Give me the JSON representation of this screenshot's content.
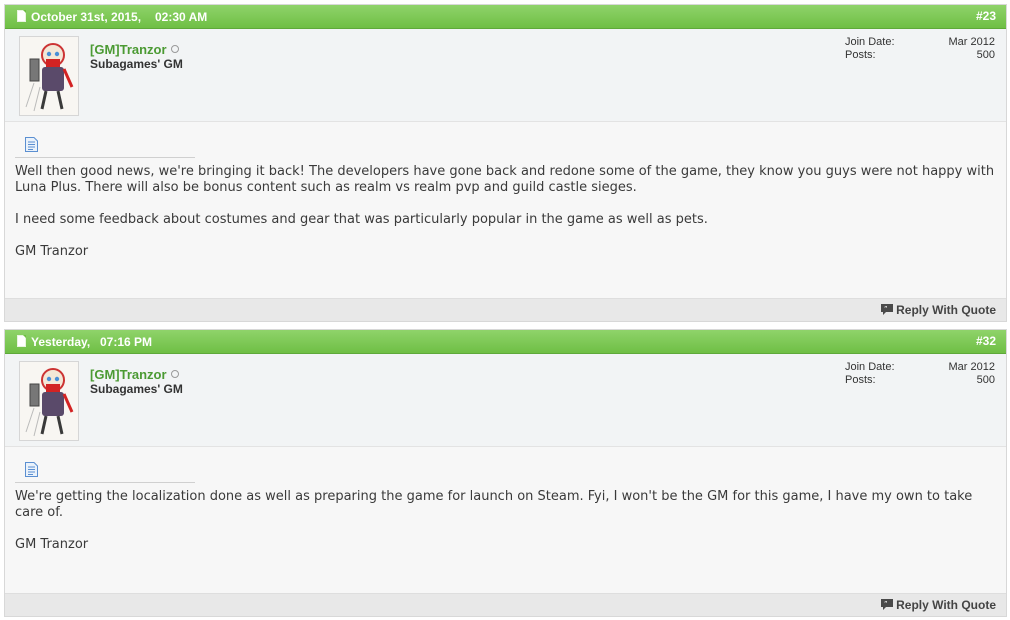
{
  "posts": [
    {
      "date": "October 31st, 2015,",
      "time": "02:30 AM",
      "number": "#23",
      "username": "[GM]Tranzor",
      "user_title": "Subagames' GM",
      "join_label": "Join Date:",
      "join_value": "Mar 2012",
      "posts_label": "Posts:",
      "posts_value": "500",
      "paragraphs": [
        "Well then good news, we're bringing it back! The developers have gone back and redone some of the game, they know you guys were not happy with Luna Plus. There will also be bonus content such as realm vs realm pvp and guild castle sieges.",
        "I need some feedback about costumes and gear that was particularly popular in the game as well as pets.",
        "GM Tranzor"
      ],
      "reply_label": "Reply With Quote"
    },
    {
      "date": "Yesterday,",
      "time": "07:16 PM",
      "number": "#32",
      "username": "[GM]Tranzor",
      "user_title": "Subagames' GM",
      "join_label": "Join Date:",
      "join_value": "Mar 2012",
      "posts_label": "Posts:",
      "posts_value": "500",
      "paragraphs": [
        "We're getting the localization done as well as preparing the game for launch on Steam. Fyi, I won't be the GM for this game, I have my own to take care of.",
        "GM Tranzor"
      ],
      "reply_label": "Reply With Quote"
    }
  ],
  "colors": {
    "header_green": "#6fbf45",
    "username_green": "#4b9a33",
    "userinfo_bg": "#f2f4f5",
    "footer_bg": "#e8e8e8"
  },
  "icons": {
    "header": "post-doc-icon",
    "message": "message-doc-icon",
    "reply": "quote-bubble-icon",
    "status": "offline-status-icon"
  }
}
